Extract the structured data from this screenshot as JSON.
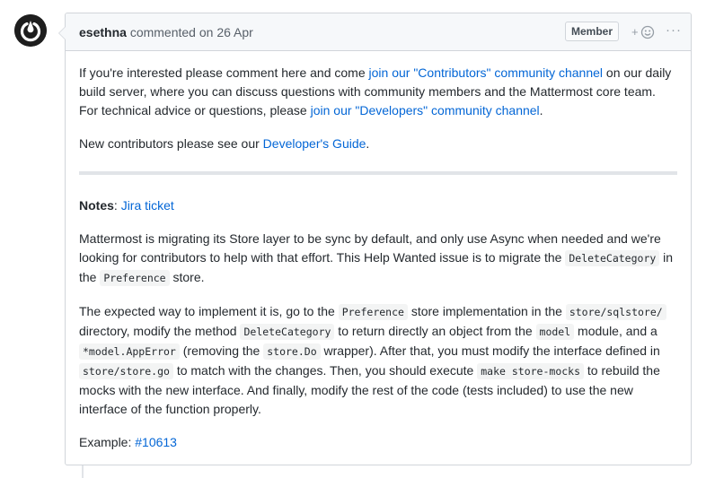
{
  "comment": {
    "author": "esethna",
    "action": "commented on",
    "date": "26 Apr",
    "badge": "Member",
    "reaction_plus": "+",
    "more_label": "···"
  },
  "body": {
    "p1": {
      "t1": "If you're interested please comment here and come ",
      "link1": "join our \"Contributors\" community channel",
      "t2": " on our daily build server, where you can discuss questions with community members and the Mattermost core team. For technical advice or questions, please ",
      "link2": "join our \"Developers\" community channel",
      "t3": "."
    },
    "p2": {
      "t1": "New contributors please see our ",
      "link1": "Developer's Guide",
      "t2": "."
    },
    "notes": {
      "label": "Notes",
      "colon": ": ",
      "link": "Jira ticket"
    },
    "p3": {
      "t1": "Mattermost is migrating its Store layer to be sync by default, and only use Async when needed and we're looking for contributors to help with that effort. This Help Wanted issue is to migrate the ",
      "c1": "DeleteCategory",
      "t2": " in the ",
      "c2": "Preference",
      "t3": " store."
    },
    "p4": {
      "t1": "The expected way to implement it is, go to the ",
      "c1": "Preference",
      "t2": " store implementation in the ",
      "c2": "store/sqlstore/",
      "t3": " directory, modify the method ",
      "c3": "DeleteCategory",
      "t4": " to return directly an object from the ",
      "c4": "model",
      "t5": " module, and a ",
      "c5": "*model.AppError",
      "t6": " (removing the ",
      "c6": "store.Do",
      "t7": " wrapper). After that, you must modify the interface defined in ",
      "c7": "store/store.go",
      "t8": " to match with the changes. Then, you should execute ",
      "c8": "make store-mocks",
      "t9": " to rebuild the mocks with the new interface. And finally, modify the rest of the code (tests included) to use the new interface of the function properly."
    },
    "example": {
      "label": "Example: ",
      "link": "#10613"
    }
  },
  "colors": {
    "link": "#0366d6",
    "header_bg": "#f6f8fa",
    "border": "#d1d5da",
    "text": "#24292e"
  },
  "icons": {
    "avatar": "mattermost-logo-icon",
    "reaction": "smiley-icon",
    "more": "kebab-horizontal-icon"
  }
}
